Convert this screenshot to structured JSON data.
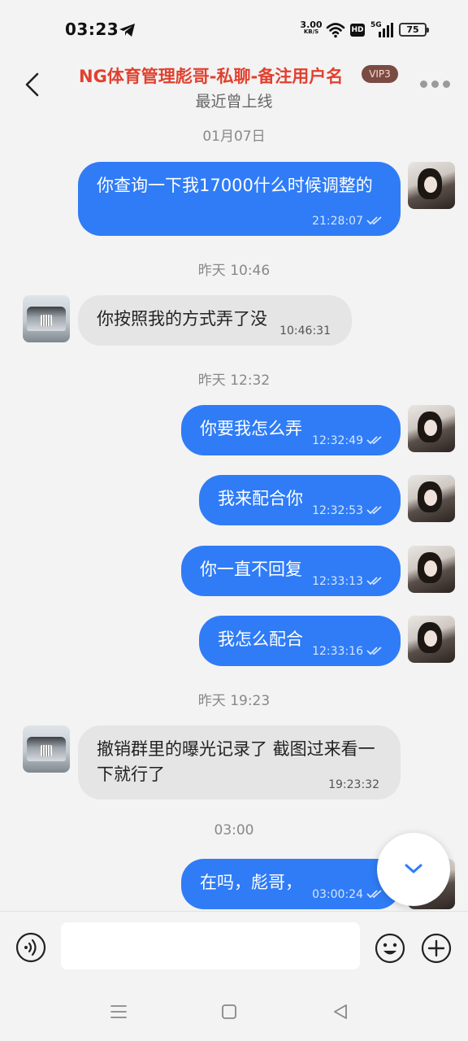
{
  "status_bar": {
    "time": "03:23",
    "net_speed_value": "3.00",
    "net_speed_unit": "KB/S",
    "hd_label": "HD",
    "network_type": "5G",
    "battery_level": "75"
  },
  "header": {
    "title": "NG体育管理彪哥-私聊-备注用户名",
    "vip_badge": "VIP3",
    "subtitle": "最近曾上线"
  },
  "messages": [
    {
      "type": "date",
      "text": "01月07日"
    },
    {
      "type": "outgoing",
      "text": "你查询一下我17000什么时候调整的",
      "time": "21:28:07",
      "read": true
    },
    {
      "type": "date",
      "text": "昨天 10:46"
    },
    {
      "type": "incoming",
      "text": "你按照我的方式弄了没",
      "time": "10:46:31"
    },
    {
      "type": "date",
      "text": "昨天 12:32"
    },
    {
      "type": "outgoing",
      "text": "你要我怎么弄",
      "time": "12:32:49",
      "read": true
    },
    {
      "type": "outgoing",
      "text": "我来配合你",
      "time": "12:32:53",
      "read": true
    },
    {
      "type": "outgoing",
      "text": "你一直不回复",
      "time": "12:33:13",
      "read": true
    },
    {
      "type": "outgoing",
      "text": "我怎么配合",
      "time": "12:33:16",
      "read": true
    },
    {
      "type": "date",
      "text": "昨天 19:23"
    },
    {
      "type": "incoming",
      "text": "撤销群里的曝光记录了 截图过来看一下就行了",
      "time": "19:23:32"
    },
    {
      "type": "date",
      "text": "03:00"
    },
    {
      "type": "outgoing",
      "text": "在吗，彪哥，",
      "time": "03:00:24",
      "read": true
    }
  ],
  "composer": {
    "value": "",
    "placeholder": ""
  },
  "icons": {
    "back": "back-arrow-icon",
    "more": "more-dots-icon",
    "voice": "voice-icon",
    "emoji": "emoji-icon",
    "plus": "plus-icon",
    "scroll_down": "chevron-down-icon",
    "read_receipt": "double-check-icon"
  },
  "colors": {
    "title": "#e0412f",
    "outgoing_bubble": "#2f7cf6",
    "incoming_bubble": "#e5e5e5",
    "background": "#f3f3f3"
  }
}
